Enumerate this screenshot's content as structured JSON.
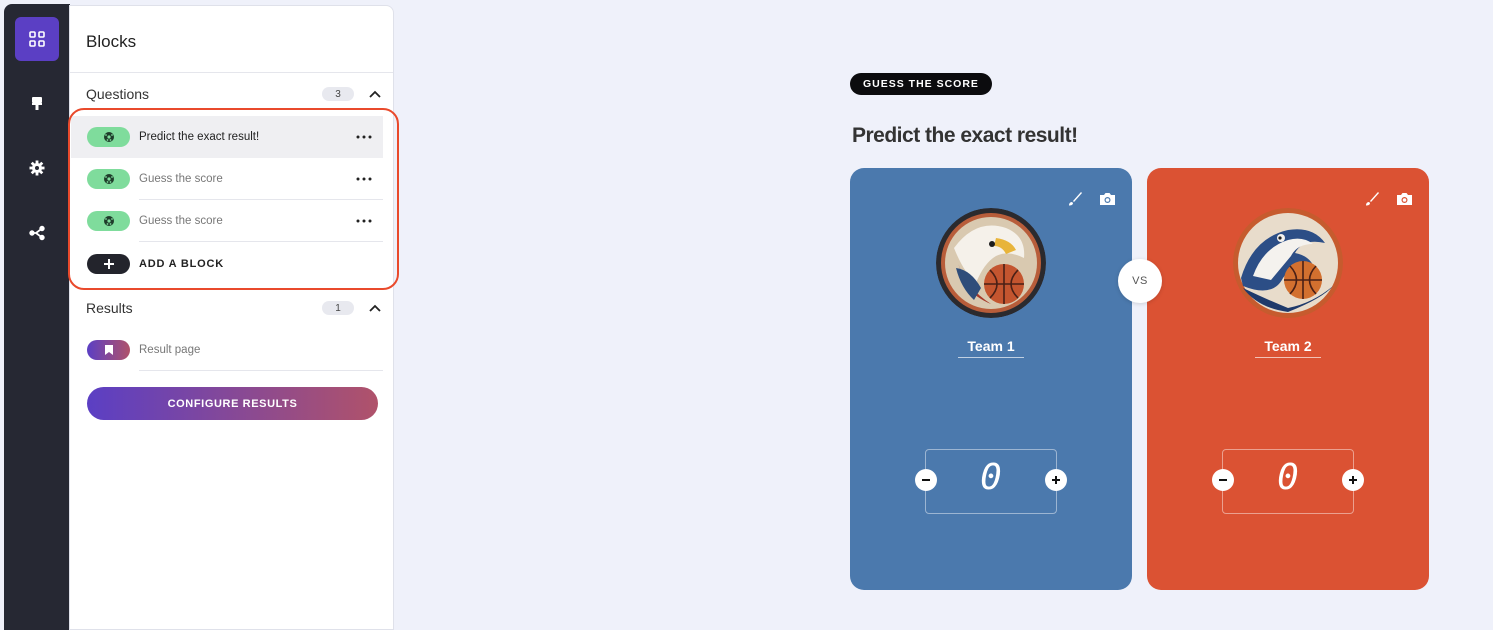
{
  "rail": {
    "items": [
      {
        "icon": "blocks-grid-icon",
        "active": true
      },
      {
        "icon": "paint-brush-icon",
        "active": false
      },
      {
        "icon": "gear-icon",
        "active": false
      },
      {
        "icon": "share-icon",
        "active": false
      }
    ]
  },
  "panel": {
    "title": "Blocks",
    "questions": {
      "label": "Questions",
      "count": "3",
      "items": [
        {
          "label": "Predict the exact result!",
          "icon": "soccer-ball-icon"
        },
        {
          "label": "Guess the score",
          "icon": "soccer-ball-icon"
        },
        {
          "label": "Guess the score",
          "icon": "soccer-ball-icon"
        }
      ],
      "add_label": "ADD A BLOCK"
    },
    "results": {
      "label": "Results",
      "count": "1",
      "items": [
        {
          "label": "Result page",
          "icon": "bookmark-icon"
        }
      ],
      "configure_label": "CONFIGURE RESULTS"
    }
  },
  "preview": {
    "tag": "GUESS THE SCORE",
    "title": "Predict the exact result!",
    "vs_label": "VS",
    "teams": [
      {
        "name": "Team 1",
        "score": "0",
        "color": "#4b79ad",
        "logo": "eagle-basketball-logo"
      },
      {
        "name": "Team 2",
        "score": "0",
        "color": "#db5233",
        "logo": "wave-basketball-logo"
      }
    ]
  }
}
